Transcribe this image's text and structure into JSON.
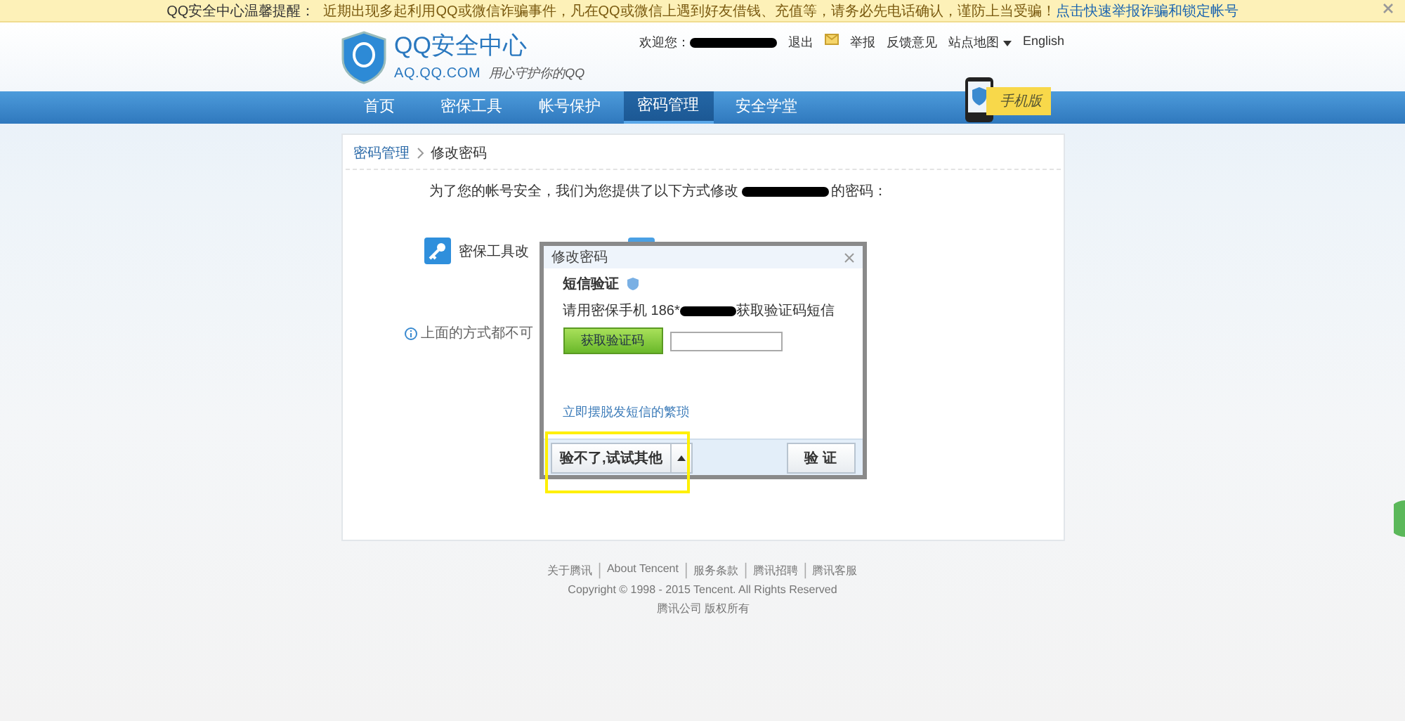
{
  "notice": {
    "label": "QQ安全中心温馨提醒：",
    "text": "近期出现多起利用QQ或微信诈骗事件，凡在QQ或微信上遇到好友借钱、充值等，请务必先电话确认，谨防上当受骗！",
    "link": "点击快速举报诈骗和锁定帐号"
  },
  "header": {
    "logo_title": "QQ安全中心",
    "logo_domain": "AQ.QQ.COM",
    "slogan": "用心守护你的QQ",
    "welcome": "欢迎您：",
    "links": [
      "退出",
      "举报",
      "反馈意见",
      "站点地图",
      "English"
    ],
    "mobile_badge": "手机版"
  },
  "nav": [
    {
      "label": "首页",
      "selected": false
    },
    {
      "label": "密保工具",
      "selected": false
    },
    {
      "label": "帐号保护",
      "selected": false
    },
    {
      "label": "密码管理",
      "selected": true
    },
    {
      "label": "安全学堂",
      "selected": false
    }
  ],
  "breadcrumb": [
    "密码管理",
    "修改密码"
  ],
  "intro": {
    "before": "为了您的帐号安全，我们为您提供了以下方式修改",
    "after": "的密码："
  },
  "options": [
    {
      "kind": "key",
      "label": "密保工具改"
    },
    {
      "kind": "message"
    }
  ],
  "info_text": "上面的方式都不可",
  "dialog": {
    "title": "修改密码",
    "heading": "短信验证",
    "prompt_before": "请用密保手机 186*",
    "prompt_after": "获取验证码短信",
    "get_code_button": "获取验证码",
    "help_link": "立即摆脱发短信的繁琐",
    "alt_button": "验不了,试试其他",
    "confirm_button": "验 证"
  },
  "footer": {
    "links": [
      "关于腾讯",
      "About Tencent",
      "服务条款",
      "腾讯招聘",
      "腾讯客服"
    ],
    "copyright": "Copyright © 1998 - 2015 Tencent. All Rights Reserved",
    "company": "腾讯公司 版权所有"
  }
}
